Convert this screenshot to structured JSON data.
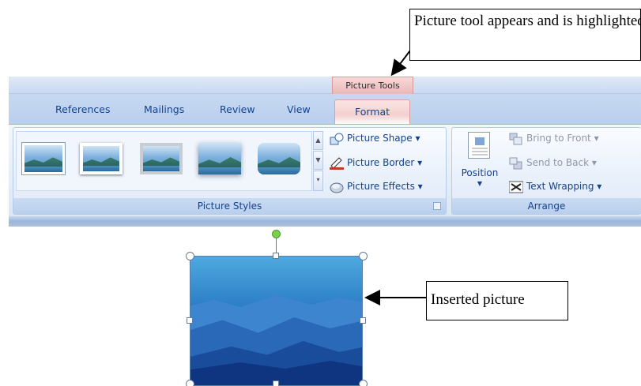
{
  "annotations": {
    "context_tab_callout": "Picture tool appears and is highlighted.",
    "picture_callout": "Inserted picture"
  },
  "ribbon": {
    "contextual_tab_group": "Picture Tools",
    "tabs": [
      {
        "label": "References"
      },
      {
        "label": "Mailings"
      },
      {
        "label": "Review"
      },
      {
        "label": "View"
      }
    ],
    "active_tab": "Format",
    "groups": {
      "picture_styles": {
        "label": "Picture Styles",
        "commands": {
          "shape": "Picture Shape ▾",
          "border": "Picture Border ▾",
          "effects": "Picture Effects ▾"
        }
      },
      "arrange": {
        "label": "Arrange",
        "position": "Position",
        "commands": {
          "bring_front": "Bring to Front ▾",
          "send_back": "Send to Back ▾",
          "text_wrapping": "Text Wrapping ▾"
        }
      }
    }
  },
  "colors": {
    "ribbon_blue": "#15428b",
    "context_pink": "#eab6b6",
    "rotate_handle": "#7ad04a"
  }
}
